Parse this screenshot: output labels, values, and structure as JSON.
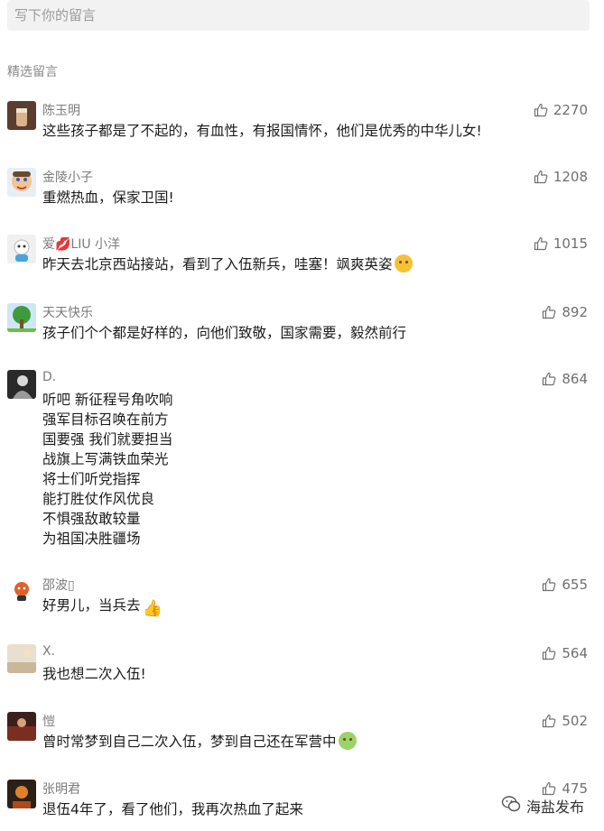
{
  "input": {
    "placeholder": "写下你的留言"
  },
  "section_title": "精选留言",
  "comments": [
    {
      "name": "陈玉明",
      "likes": "2270",
      "lines": [
        "这些孩子都是了不起的，有血性，有报国情怀，他们是优秀的中华儿女!"
      ]
    },
    {
      "name": "金陵小子",
      "likes": "1208",
      "lines": [
        "重燃热血，保家卫国!"
      ]
    },
    {
      "name": "爱💋LIU 小洋",
      "likes": "1015",
      "lines": [
        "昨天去北京西站接站，看到了入伍新兵，哇塞！飒爽英姿"
      ]
    },
    {
      "name": "天天快乐",
      "likes": "892",
      "lines": [
        "孩子们个个都是好样的，向他们致敬，国家需要，毅然前行"
      ]
    },
    {
      "name": "D.",
      "likes": "864",
      "lines": [
        "听吧 新征程号角吹响",
        "强军目标召唤在前方",
        "国要强 我们就要担当",
        "战旗上写满铁血荣光",
        "将士们听党指挥",
        "能打胜仗作风优良",
        "不惧强敌敢较量",
        "为祖国决胜疆场"
      ]
    },
    {
      "name": "邵波▯",
      "likes": "655",
      "lines": [
        "好男儿，当兵去"
      ]
    },
    {
      "name": "X.",
      "likes": "564",
      "lines": [
        "我也想二次入伍!"
      ]
    },
    {
      "name": "愷",
      "likes": "502",
      "lines": [
        "曾时常梦到自己二次入伍，梦到自己还在军营中"
      ]
    },
    {
      "name": "张明君",
      "likes": "475",
      "lines": [
        "退伍4年了，看了他们，我再次热血了起来"
      ]
    }
  ],
  "watermark": {
    "text": "海盐发布"
  }
}
